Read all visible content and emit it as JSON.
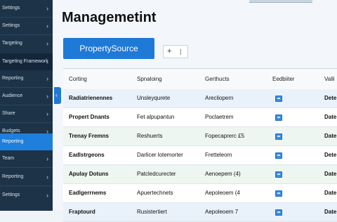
{
  "sidebar": {
    "items": [
      {
        "label": "Settings",
        "chevron": "›"
      },
      {
        "label": "Settings",
        "chevron": "›"
      },
      {
        "label": "Targeting",
        "chevron": "›"
      },
      {
        "label": "Targeting Framework",
        "chevron": "›"
      },
      {
        "label": "Reporting",
        "chevron": "›"
      },
      {
        "label": "Audience",
        "chevron": "›"
      },
      {
        "label": "Share",
        "chevron": "›"
      },
      {
        "label": "Budgets",
        "chevron": "›"
      },
      {
        "label": "Reporting",
        "chevron": "›"
      },
      {
        "label": "Team",
        "chevron": "›"
      },
      {
        "label": "Reporting",
        "chevron": "›"
      },
      {
        "label": "Settings",
        "chevron": "›"
      }
    ]
  },
  "header": {
    "title": "Managemetint",
    "primary_button": "PropertySource",
    "tool_plus": "+",
    "tool_bar": "|"
  },
  "table": {
    "columns": [
      "Corting",
      "Spnaloing",
      "Gerthucts",
      "Eedbiiter",
      "Valli"
    ],
    "rows": [
      [
        "Radiatrienennes",
        "Unsleyqurete",
        "Arecliopern",
        "",
        "Dete"
      ],
      [
        "Propert Dnants",
        "Fet alpupantun",
        "Poclaetrem",
        "",
        "Date"
      ],
      [
        "Trenay Fremns",
        "Reshuerts",
        "Fopecaprerc £5",
        "",
        "Date"
      ],
      [
        "Eadlstrgeons",
        "Darlicer lotemorter",
        "Fretteleom",
        "",
        "Dete"
      ],
      [
        "Apulay Dotuns",
        "Patcledcurecter",
        "Aenoepem (4)",
        "",
        "Date"
      ],
      [
        "Eadlgerrnems",
        "Apuertechnets",
        "Aepoleoem (4",
        "",
        "Date"
      ],
      [
        "Fraptourd",
        "Rusistertiert",
        "Aepoleoem 7",
        "",
        "Date"
      ]
    ]
  },
  "colors": {
    "sidebar_bg": "#1d3347",
    "accent": "#1f79d6",
    "active_item": "#1e7fdc"
  },
  "icons": {
    "row_icon": "file-icon",
    "chevron": "chevron-right-icon",
    "collapse": "chevron-left-icon"
  }
}
